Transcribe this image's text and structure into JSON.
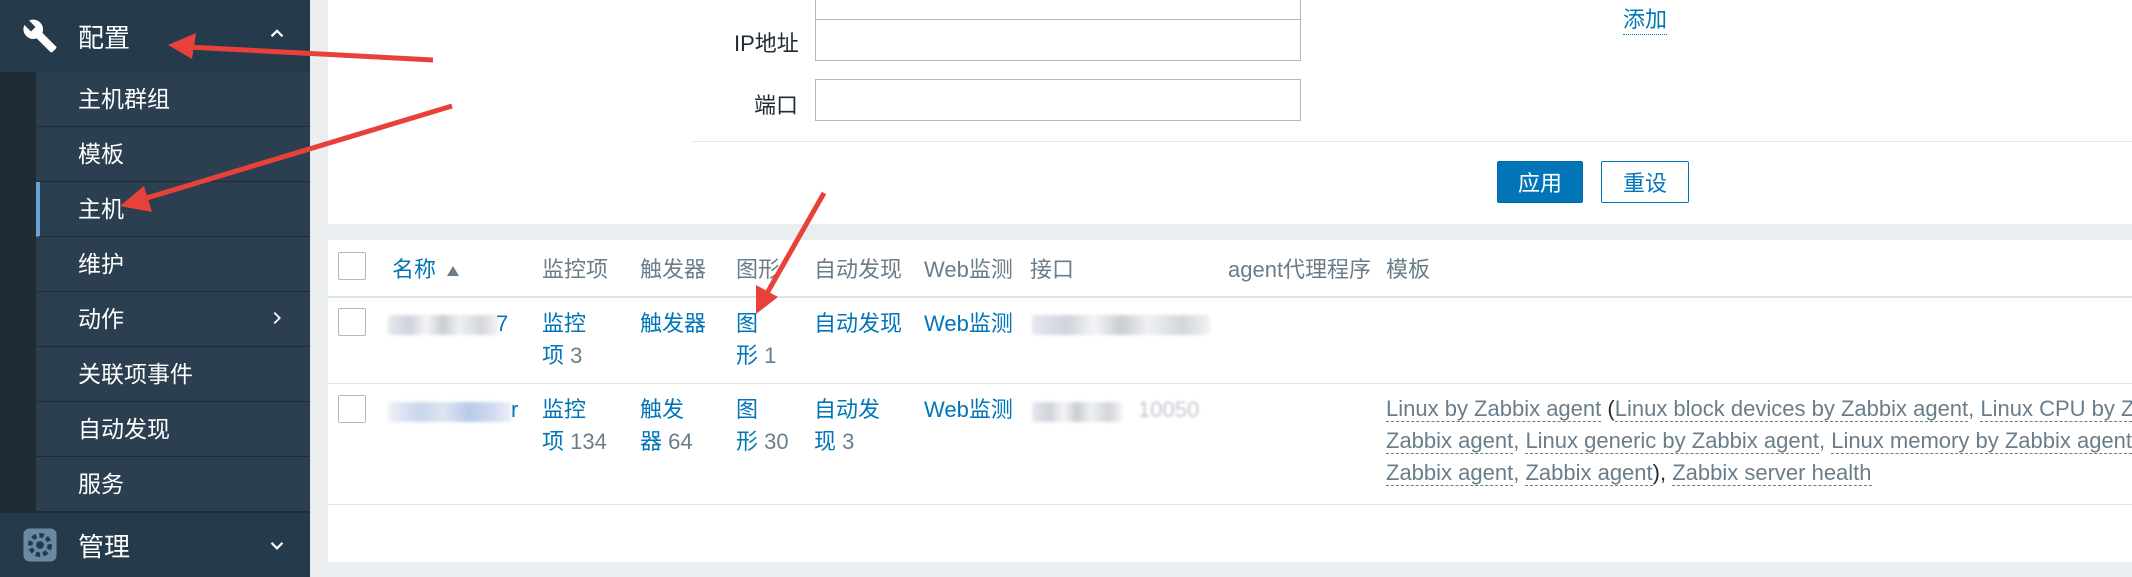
{
  "sidebar": {
    "config": {
      "label": "配置",
      "icon": "wrench-icon"
    },
    "items": [
      {
        "label": "主机群组"
      },
      {
        "label": "模板"
      },
      {
        "label": "主机"
      },
      {
        "label": "维护"
      },
      {
        "label": "动作"
      },
      {
        "label": "关联项事件"
      },
      {
        "label": "自动发现"
      },
      {
        "label": "服务"
      }
    ],
    "admin": {
      "label": "管理",
      "icon": "gear-icon"
    }
  },
  "filter": {
    "ip_label": "IP地址",
    "port_label": "端口",
    "add_link": "添加",
    "apply_label": "应用",
    "reset_label": "重设"
  },
  "table": {
    "columns": {
      "name": "名称",
      "items": "监控项",
      "triggers": "触发器",
      "graphs": "图形",
      "discovery": "自动发现",
      "web": "Web监测",
      "interface": "接口",
      "proxy": "agent代理程序",
      "templates": "模板"
    },
    "rows": [
      {
        "name_tail": "7",
        "items": {
          "label": "监控项",
          "line1": "监控",
          "line2": "项",
          "count": "3"
        },
        "triggers": {
          "label": "触发器"
        },
        "graphs": {
          "line1": "图",
          "line2": "形",
          "count": "1"
        },
        "discovery": {
          "label": "自动发现"
        },
        "web": {
          "label": "Web监测"
        }
      },
      {
        "name_tail": "r",
        "items": {
          "line1": "监控",
          "line2": "项",
          "count": "134"
        },
        "triggers": {
          "line1": "触发",
          "line2": "器",
          "count": "64"
        },
        "graphs": {
          "line1": "图",
          "line2": "形",
          "count": "30"
        },
        "discovery": {
          "line1": "自动发",
          "line2": "现",
          "count": "3"
        },
        "web": {
          "label": "Web监测"
        },
        "interface_tail": "10050",
        "templates": {
          "t1": "Linux by Zabbix agent",
          "open": " (",
          "t2": "Linux block devices by Zabbix agent",
          "comma1": ", ",
          "t3": "Linux CPU by Za",
          "t4": "Zabbix agent",
          "comma2": ", ",
          "t5": "Linux generic by Zabbix agent",
          "comma3": ", ",
          "t6": "Linux memory by Zabbix agent",
          "comma4": ",",
          "t7": "Zabbix agent",
          "comma5": ", ",
          "t8": "Zabbix agent",
          "close": "), ",
          "t9": "Zabbix server health"
        }
      }
    ]
  },
  "colors": {
    "accent": "#0275b8",
    "annotation": "#e8413a"
  }
}
